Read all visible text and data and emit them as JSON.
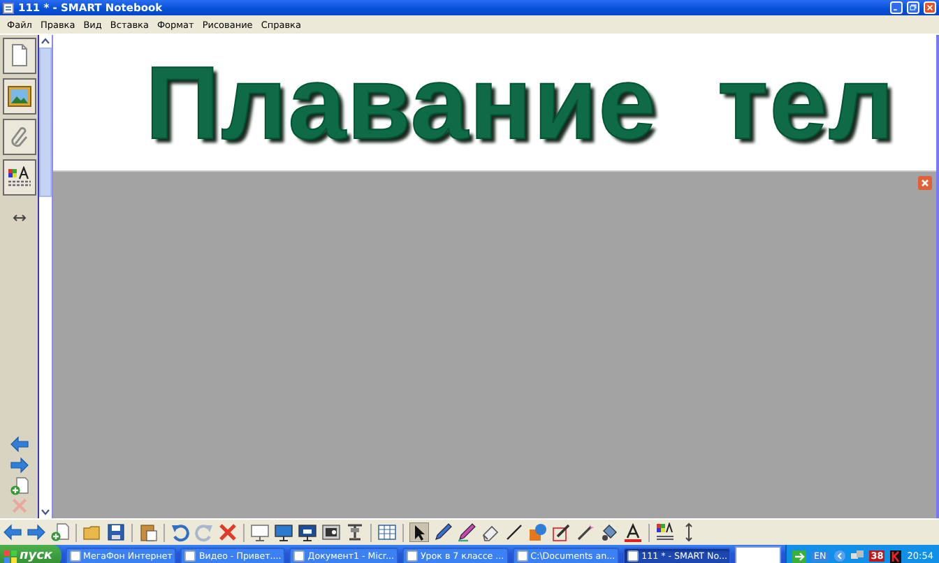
{
  "window": {
    "title": "111 * - SMART Notebook"
  },
  "menu": [
    "Файл",
    "Правка",
    "Вид",
    "Вставка",
    "Формат",
    "Рисование",
    "Справка"
  ],
  "page": {
    "title": "Плавание  тел"
  },
  "taskbar": {
    "start": "пуск",
    "tasks": [
      {
        "label": "МегаФон Интернет",
        "selected": false
      },
      {
        "label": "Видео - Привет....",
        "selected": false
      },
      {
        "label": "Документ1 - Micr...",
        "selected": false
      },
      {
        "label": "Урок в 7 классе ...",
        "selected": false
      },
      {
        "label": "C:\\Documents an...",
        "selected": false
      },
      {
        "label": "111 * - SMART No...",
        "selected": true
      }
    ],
    "language": "EN",
    "tray_count": "38",
    "clock": "20:54"
  }
}
